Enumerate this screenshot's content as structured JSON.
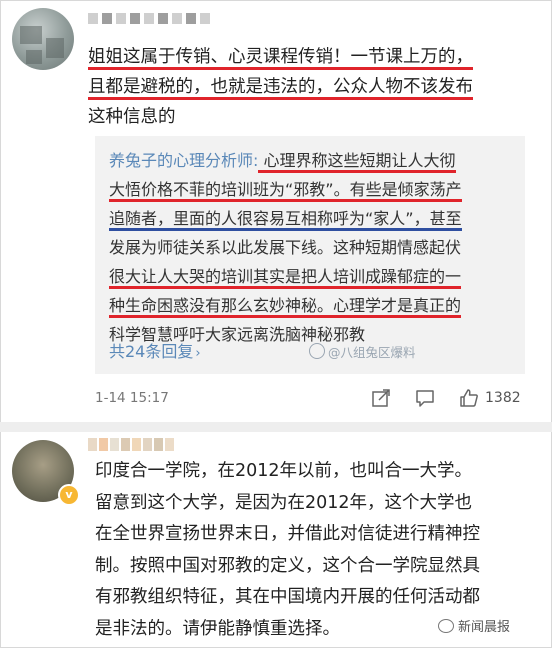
{
  "comment1": {
    "lines": [
      "姐姐这属于传销、心灵课程传销！一节课上万的，",
      "且都是避税的，也就是违法的，公众人物不该发布",
      "这种信息的"
    ],
    "quote": {
      "user": "养兔子的心理分析师:",
      "line1": " 心理界称这些短期让人大彻",
      "line2": "大悟价格不菲的培训班为“邪教”。有些是倾家荡产",
      "line3": "追随者，里面的人很容易互相称呼为“家人”，甚至",
      "line4": "发展为师徒关系以此发展下线。这种短期情感起伏",
      "line5": "很大让人大哭的培训其实是把人培训成躁郁症的一",
      "line6": "种生命困惑没有那么玄妙神秘。心理学才是真正的",
      "line7": "科学智慧呼吁大家远离洗脑神秘邪教",
      "reply_label": "共24条回复",
      "reply_chevron": "›",
      "watermark": "@八组兔区爆料"
    },
    "meta": {
      "time": "1-14 15:17",
      "like_count": "1382",
      "icons": [
        "share-icon",
        "comment-icon",
        "like-icon"
      ]
    }
  },
  "comment2": {
    "lines": [
      "印度合一学院，在2012年以前，也叫合一大学。",
      "留意到这个大学，是因为在2012年，这个大学也",
      "在全世界宣扬世界末日，并借此对信徒进行精神控",
      "制。按照中国对邪教的定义，这个合一学院显然具",
      "有邪教组织特征，其在中国境内开展的任何活动都",
      "是非法的。请伊能静慎重选择。"
    ],
    "badge": "v",
    "source": "新闻晨报"
  },
  "colors": {
    "underline_red": "#e0242b",
    "underline_blue": "#2f4fa0",
    "link_blue": "#5a88b8",
    "quote_bg": "#f2f2f2"
  }
}
